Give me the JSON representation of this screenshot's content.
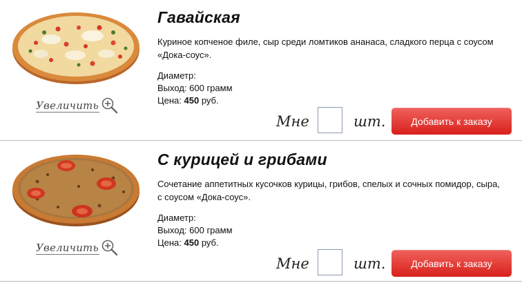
{
  "products": [
    {
      "zoom_label": "Увеличить",
      "title": "Гавайская",
      "description": "Куриное копченое филе, сыр среди ломтиков ананаса, сладкого перца с соусом «Дока-соус».",
      "diameter_label": "Диаметр:",
      "yield_label": "Выход:",
      "yield_value": "600 грамм",
      "price_label": "Цена:",
      "price_value": "450",
      "price_currency": "руб.",
      "qty_prefix": "Мне",
      "qty_value": "",
      "qty_unit": "шт.",
      "add_button": "Добавить к заказу"
    },
    {
      "zoom_label": "Увеличить",
      "title": "С курицей и грибами",
      "description": "Сочетание аппетитных кусочков курицы, грибов, спелых и сочных помидор, сыра, с соусом «Дока-соус».",
      "diameter_label": "Диаметр:",
      "yield_label": "Выход:",
      "yield_value": "600 грамм",
      "price_label": "Цена:",
      "price_value": "450",
      "price_currency": "руб.",
      "qty_prefix": "Мне",
      "qty_value": "",
      "qty_unit": "шт.",
      "add_button": "Добавить к заказу"
    }
  ],
  "colors": {
    "button_top": "#f0625d",
    "button_bottom": "#d8201b",
    "divider": "#b9b9b9",
    "input_border": "#8a9ab0"
  },
  "icons": {
    "zoom": "magnifier-plus-icon"
  }
}
